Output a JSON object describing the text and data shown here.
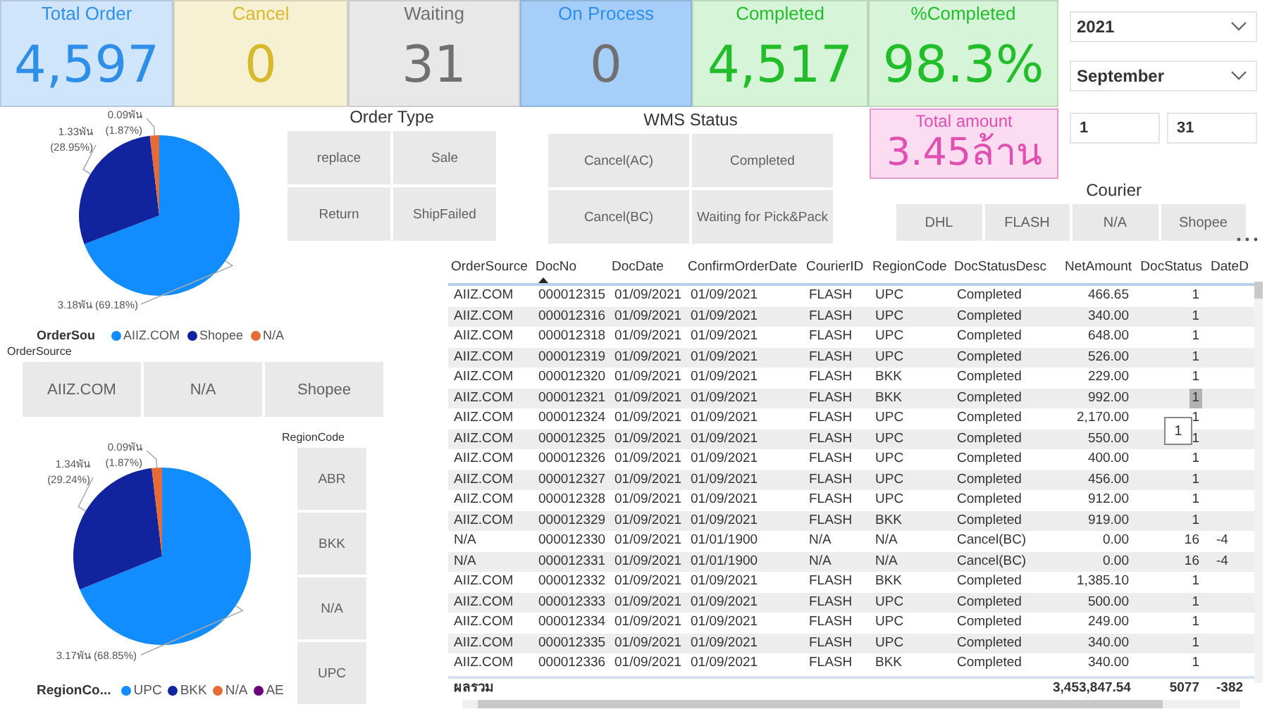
{
  "kpis": [
    {
      "title": "Total Order",
      "value": "4,597",
      "color": "#2f8fe8"
    },
    {
      "title": "Cancel",
      "value": "0",
      "color": "#d8b92c"
    },
    {
      "title": "Waiting",
      "value": "31",
      "color": "#707070"
    },
    {
      "title": "On Process",
      "value": "0",
      "color": "#2f8fe8"
    },
    {
      "title": "Completed",
      "value": "4,517",
      "color": "#21bd2a"
    },
    {
      "title": "%Completed",
      "value": "98.3%",
      "color": "#21bd2a"
    }
  ],
  "total_amount": {
    "title": "Total amount",
    "value": "3.45ล้าน"
  },
  "date_filters": {
    "year": "2021",
    "month": "September",
    "day_from": "1",
    "day_to": "31"
  },
  "order_type": {
    "title": "Order Type",
    "options": [
      {
        "label": "replace",
        "selected": false
      },
      {
        "label": "Sale",
        "selected": false
      },
      {
        "label": "Return",
        "selected": false
      },
      {
        "label": "ShipFailed",
        "selected": false
      }
    ]
  },
  "wms_status": {
    "title": "WMS Status",
    "options": [
      {
        "label": "Cancel(AC)",
        "selected": false
      },
      {
        "label": "Completed",
        "selected": false
      },
      {
        "label": "Cancel(BC)",
        "selected": false
      },
      {
        "label": "Waiting for Pick&Pack",
        "selected": false
      }
    ]
  },
  "courier": {
    "title": "Courier",
    "options": [
      {
        "label": "DHL",
        "selected": false
      },
      {
        "label": "FLASH",
        "selected": false
      },
      {
        "label": "N/A",
        "selected": false
      },
      {
        "label": "Shopee",
        "selected": false
      }
    ]
  },
  "order_source": {
    "title": "OrderSource",
    "options": [
      {
        "label": "AIIZ.COM",
        "selected": false
      },
      {
        "label": "N/A",
        "selected": false
      },
      {
        "label": "Shopee",
        "selected": false
      }
    ]
  },
  "region_code": {
    "title": "RegionCode",
    "options": [
      {
        "label": "ABR",
        "selected": false
      },
      {
        "label": "BKK",
        "selected": false
      },
      {
        "label": "N/A",
        "selected": false
      },
      {
        "label": "UPC",
        "selected": false
      }
    ]
  },
  "source_pie": {
    "chart_data": {
      "type": "pie",
      "categories": [
        "AIIZ.COM",
        "Shopee",
        "N/A"
      ],
      "values": [
        69.18,
        28.95,
        1.87
      ],
      "value_labels": [
        "3.18พัน (69.18%)",
        "1.33พัน (28.95%)",
        "0.09พัน (1.87%)"
      ]
    },
    "legend": {
      "title": "OrderSou",
      "items": [
        {
          "color": "#118dff"
        },
        {
          "color": "#12239e"
        },
        {
          "color": "#e66c37"
        }
      ]
    }
  },
  "region_pie": {
    "chart_data": {
      "type": "pie",
      "categories": [
        "UPC",
        "BKK",
        "N/A"
      ],
      "values": [
        68.85,
        29.24,
        1.87
      ],
      "value_labels": [
        "3.17พัน (68.85%)",
        "1.34พัน (29.24%)",
        "0.09พัน (1.87%)"
      ]
    },
    "legend": {
      "title": "RegionCo...",
      "items": [
        {
          "color": "#118dff"
        },
        {
          "color": "#12239e"
        },
        {
          "color": "#e66c37"
        },
        {
          "label": "AE",
          "color": "#6b007b"
        }
      ]
    }
  },
  "table": {
    "columns": [
      {
        "label": "OrderSource",
        "sorted": false
      },
      {
        "label": "DocNo",
        "sorted": true
      },
      {
        "label": "DocDate",
        "sorted": false
      },
      {
        "label": "ConfirmOrderDate",
        "sorted": false
      },
      {
        "label": "CourierID",
        "sorted": false
      },
      {
        "label": "RegionCode",
        "sorted": false
      },
      {
        "label": "DocStatusDesc",
        "sorted": false
      },
      {
        "label": "NetAmount",
        "sorted": false
      },
      {
        "label": "DocStatus",
        "sorted": false
      },
      {
        "label": "DateD",
        "sorted": false
      }
    ],
    "rows": [
      {
        "cells": [
          "AIIZ.COM",
          "000012315",
          "01/09/2021",
          "01/09/2021",
          "FLASH",
          "UPC",
          "Completed",
          "466.65",
          "1"
        ],
        "selected": false
      },
      {
        "cells": [
          "AIIZ.COM",
          "000012316",
          "01/09/2021",
          "01/09/2021",
          "FLASH",
          "UPC",
          "Completed",
          "340.00",
          "1"
        ],
        "selected": false
      },
      {
        "cells": [
          "AIIZ.COM",
          "000012318",
          "01/09/2021",
          "01/09/2021",
          "FLASH",
          "UPC",
          "Completed",
          "648.00",
          "1"
        ],
        "selected": false
      },
      {
        "cells": [
          "AIIZ.COM",
          "000012319",
          "01/09/2021",
          "01/09/2021",
          "FLASH",
          "UPC",
          "Completed",
          "526.00",
          "1"
        ],
        "selected": false
      },
      {
        "cells": [
          "AIIZ.COM",
          "000012320",
          "01/09/2021",
          "01/09/2021",
          "FLASH",
          "BKK",
          "Completed",
          "229.00",
          "1"
        ],
        "selected": false
      },
      {
        "cells": [
          "AIIZ.COM",
          "000012321",
          "01/09/2021",
          "01/09/2021",
          "FLASH",
          "BKK",
          "Completed",
          "992.00",
          "1"
        ],
        "selected": true
      },
      {
        "cells": [
          "AIIZ.COM",
          "000012324",
          "01/09/2021",
          "01/09/2021",
          "FLASH",
          "UPC",
          "Completed",
          "2,170.00",
          "1"
        ],
        "selected": false
      },
      {
        "cells": [
          "AIIZ.COM",
          "000012325",
          "01/09/2021",
          "01/09/2021",
          "FLASH",
          "UPC",
          "Completed",
          "550.00",
          "1"
        ],
        "selected": false
      },
      {
        "cells": [
          "AIIZ.COM",
          "000012326",
          "01/09/2021",
          "01/09/2021",
          "FLASH",
          "UPC",
          "Completed",
          "400.00",
          "1"
        ],
        "selected": false
      },
      {
        "cells": [
          "AIIZ.COM",
          "000012327",
          "01/09/2021",
          "01/09/2021",
          "FLASH",
          "UPC",
          "Completed",
          "456.00",
          "1"
        ],
        "selected": false
      },
      {
        "cells": [
          "AIIZ.COM",
          "000012328",
          "01/09/2021",
          "01/09/2021",
          "FLASH",
          "UPC",
          "Completed",
          "912.00",
          "1"
        ],
        "selected": false
      },
      {
        "cells": [
          "AIIZ.COM",
          "000012329",
          "01/09/2021",
          "01/09/2021",
          "FLASH",
          "BKK",
          "Completed",
          "919.00",
          "1"
        ],
        "selected": false
      },
      {
        "cells": [
          "N/A",
          "000012330",
          "01/09/2021",
          "01/01/1900",
          "N/A",
          "N/A",
          "Cancel(BC)",
          "0.00",
          "16"
        ],
        "column_10": "-4",
        "selected": false
      },
      {
        "cells": [
          "N/A",
          "000012331",
          "01/09/2021",
          "01/01/1900",
          "N/A",
          "N/A",
          "Cancel(BC)",
          "0.00",
          "16"
        ],
        "column_10": "-4",
        "selected": false
      },
      {
        "cells": [
          "AIIZ.COM",
          "000012332",
          "01/09/2021",
          "01/09/2021",
          "FLASH",
          "BKK",
          "Completed",
          "1,385.10",
          "1"
        ],
        "selected": false
      },
      {
        "cells": [
          "AIIZ.COM",
          "000012333",
          "01/09/2021",
          "01/09/2021",
          "FLASH",
          "UPC",
          "Completed",
          "500.00",
          "1"
        ],
        "selected": false
      },
      {
        "cells": [
          "AIIZ.COM",
          "000012334",
          "01/09/2021",
          "01/09/2021",
          "FLASH",
          "UPC",
          "Completed",
          "249.00",
          "1"
        ],
        "selected": false
      },
      {
        "cells": [
          "AIIZ.COM",
          "000012335",
          "01/09/2021",
          "01/09/2021",
          "FLASH",
          "UPC",
          "Completed",
          "340.00",
          "1"
        ],
        "selected": false
      },
      {
        "cells": [
          "AIIZ.COM",
          "000012336",
          "01/09/2021",
          "01/09/2021",
          "FLASH",
          "BKK",
          "Completed",
          "340.00",
          "1"
        ],
        "selected": false
      }
    ],
    "totals": {
      "label": "ผลรวม",
      "values": [
        "3,453,847.54",
        "5077",
        "-382"
      ]
    },
    "tooltip": "1"
  }
}
